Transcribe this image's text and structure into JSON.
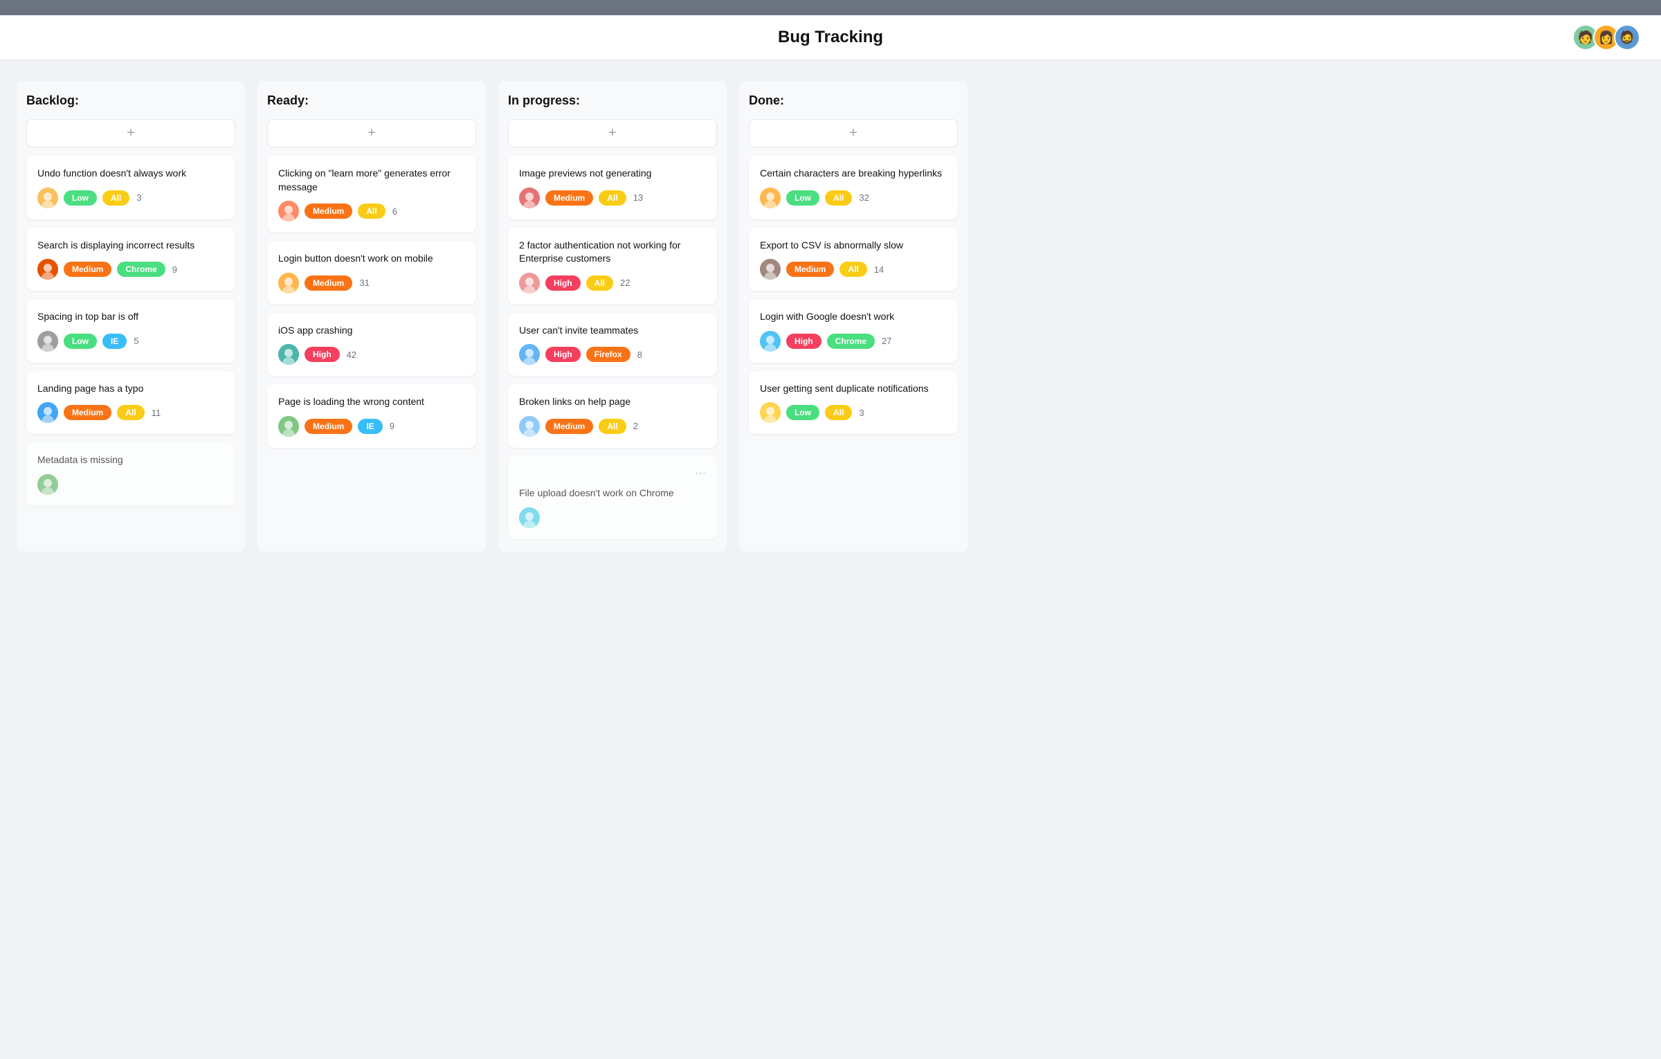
{
  "header": {
    "title": "Bug Tracking",
    "avatars": [
      "🧑",
      "👩",
      "🧔"
    ]
  },
  "columns": [
    {
      "id": "backlog",
      "label": "Backlog:",
      "cards": [
        {
          "title": "Undo function doesn't always work",
          "avatar": "🟡",
          "avatarColor": "#f9a825",
          "priority": "Low",
          "priorityClass": "badge-low",
          "tag": "All",
          "tagClass": "badge-all",
          "count": "3"
        },
        {
          "title": "Search is displaying incorrect results",
          "avatar": "🔵",
          "avatarColor": "#1565c0",
          "priority": "Medium",
          "priorityClass": "badge-medium",
          "tag": "Chrome",
          "tagClass": "badge-chrome",
          "count": "9"
        },
        {
          "title": "Spacing in top bar is off",
          "avatar": "🟠",
          "avatarColor": "#e65100",
          "priority": "Low",
          "priorityClass": "badge-low",
          "tag": "IE",
          "tagClass": "badge-ie",
          "count": "5"
        },
        {
          "title": "Landing page has a typo",
          "avatar": "🔵",
          "avatarColor": "#1976d2",
          "priority": "Medium",
          "priorityClass": "badge-medium",
          "tag": "All",
          "tagClass": "badge-all",
          "count": "11"
        },
        {
          "title": "Metadata is missing",
          "avatar": "🟢",
          "avatarColor": "#2e7d32",
          "priority": "",
          "priorityClass": "",
          "tag": "",
          "tagClass": "",
          "count": "",
          "partial": true
        }
      ]
    },
    {
      "id": "ready",
      "label": "Ready:",
      "cards": [
        {
          "title": "Clicking on \"learn more\" generates error message",
          "avatar": "🟠",
          "avatarColor": "#bf360c",
          "priority": "Medium",
          "priorityClass": "badge-medium",
          "tag": "All",
          "tagClass": "badge-all",
          "count": "6"
        },
        {
          "title": "Login button doesn't work on mobile",
          "avatar": "🟠",
          "avatarColor": "#e65100",
          "priority": "Medium",
          "priorityClass": "badge-medium",
          "tag": "",
          "tagClass": "",
          "count": "31"
        },
        {
          "title": "iOS app crashing",
          "avatar": "🟢",
          "avatarColor": "#1b5e20",
          "priority": "High",
          "priorityClass": "badge-high",
          "tag": "",
          "tagClass": "",
          "count": "42"
        },
        {
          "title": "Page is loading the wrong content",
          "avatar": "🟢",
          "avatarColor": "#388e3c",
          "priority": "Medium",
          "priorityClass": "badge-medium",
          "tag": "IE",
          "tagClass": "badge-ie",
          "count": "9"
        }
      ]
    },
    {
      "id": "in-progress",
      "label": "In progress:",
      "cards": [
        {
          "title": "Image previews not generating",
          "avatar": "🔴",
          "avatarColor": "#c62828",
          "priority": "Medium",
          "priorityClass": "badge-medium",
          "tag": "All",
          "tagClass": "badge-all",
          "count": "13"
        },
        {
          "title": "2 factor authentication not working for Enterprise customers",
          "avatar": "🔴",
          "avatarColor": "#b71c1c",
          "priority": "High",
          "priorityClass": "badge-high",
          "tag": "All",
          "tagClass": "badge-all",
          "count": "22"
        },
        {
          "title": "User can't invite teammates",
          "avatar": "🔵",
          "avatarColor": "#0277bd",
          "priority": "High",
          "priorityClass": "badge-high",
          "tag": "Firefox",
          "tagClass": "badge-firefox",
          "count": "8"
        },
        {
          "title": "Broken links on help page",
          "avatar": "🔵",
          "avatarColor": "#1565c0",
          "priority": "Medium",
          "priorityClass": "badge-medium",
          "tag": "All",
          "tagClass": "badge-all",
          "count": "2"
        },
        {
          "title": "File upload doesn't work on Chrome",
          "avatar": "🔵",
          "avatarColor": "#0288d1",
          "priority": "",
          "priorityClass": "",
          "tag": "",
          "tagClass": "",
          "count": "",
          "partial": true,
          "hasDots": true
        }
      ]
    },
    {
      "id": "done",
      "label": "Done:",
      "cards": [
        {
          "title": "Certain characters are breaking hyperlinks",
          "avatar": "🟠",
          "avatarColor": "#e65100",
          "priority": "Low",
          "priorityClass": "badge-low",
          "tag": "All",
          "tagClass": "badge-all",
          "count": "32"
        },
        {
          "title": "Export to CSV is abnormally slow",
          "avatar": "🟤",
          "avatarColor": "#4e342e",
          "priority": "Medium",
          "priorityClass": "badge-medium",
          "tag": "All",
          "tagClass": "badge-all",
          "count": "14"
        },
        {
          "title": "Login with Google doesn't work",
          "avatar": "🔵",
          "avatarColor": "#01579b",
          "priority": "High",
          "priorityClass": "badge-high",
          "tag": "Chrome",
          "tagClass": "badge-chrome",
          "count": "27"
        },
        {
          "title": "User getting sent duplicate notifications",
          "avatar": "🟡",
          "avatarColor": "#f57f17",
          "priority": "Low",
          "priorityClass": "badge-low",
          "tag": "All",
          "tagClass": "badge-all",
          "count": "3"
        }
      ]
    }
  ],
  "addButton": "+",
  "avatarEmojis": {
    "backlog_0": "😊",
    "backlog_1": "🧑",
    "backlog_2": "😐",
    "backlog_3": "👤",
    "backlog_4": "🟢",
    "ready_0": "👩",
    "ready_1": "👩",
    "ready_2": "🧑",
    "ready_3": "🧑",
    "inprogress_0": "👩",
    "inprogress_1": "👩",
    "inprogress_2": "🧑",
    "inprogress_3": "🧑",
    "inprogress_4": "🧑",
    "done_0": "👩",
    "done_1": "🧑",
    "done_2": "🧑",
    "done_3": "🧑"
  }
}
